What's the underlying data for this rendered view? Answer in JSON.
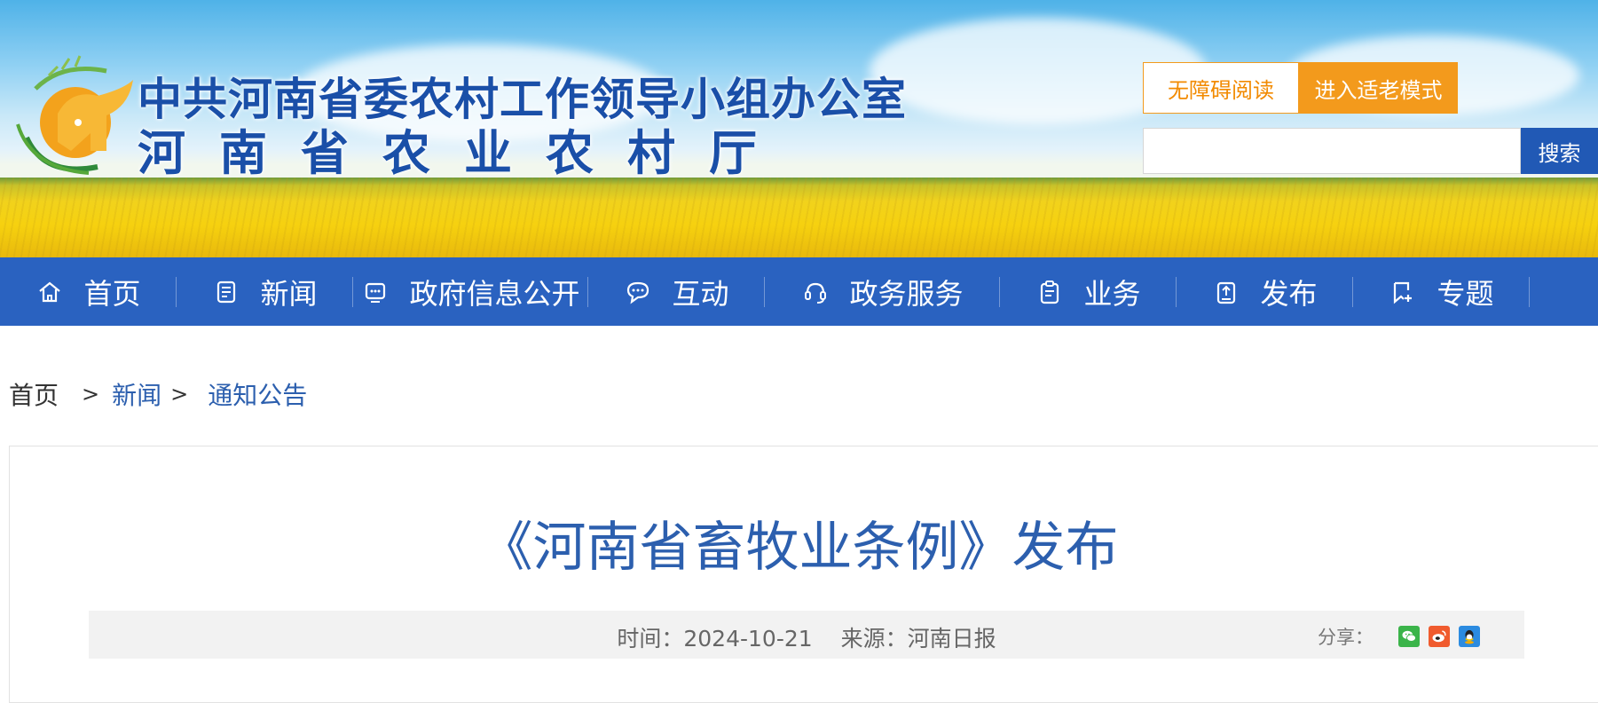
{
  "header": {
    "title_line1": "中共河南省委农村工作领导小组办公室",
    "title_line2": "河南省农业农村厅",
    "accessible_label": "无障碍阅读",
    "elder_mode_label": "进入适老模式",
    "search_placeholder": "",
    "search_label": "搜索"
  },
  "nav": {
    "items": [
      {
        "label": "首页",
        "icon": "home-icon"
      },
      {
        "label": "新闻",
        "icon": "news-icon"
      },
      {
        "label": "政府信息公开",
        "icon": "info-icon"
      },
      {
        "label": "互动",
        "icon": "chat-icon"
      },
      {
        "label": "政务服务",
        "icon": "service-icon"
      },
      {
        "label": "业务",
        "icon": "clipboard-icon"
      },
      {
        "label": "发布",
        "icon": "publish-icon"
      },
      {
        "label": "专题",
        "icon": "topic-icon"
      }
    ]
  },
  "breadcrumb": {
    "home": "首页",
    "sep": ">",
    "level1": "新闻",
    "level2": "通知公告"
  },
  "article": {
    "title": "《河南省畜牧业条例》发布",
    "time": "时间：2024-10-21",
    "source": "来源：河南日报",
    "share_label": "分享："
  },
  "colors": {
    "nav_blue": "#2a62c0",
    "title_blue": "#2c5fae",
    "orange": "#f39a1c"
  }
}
